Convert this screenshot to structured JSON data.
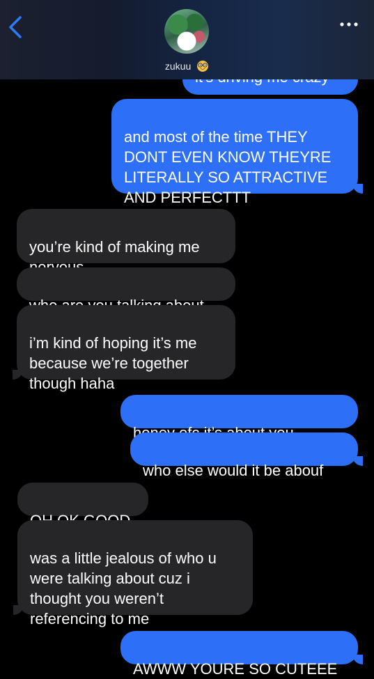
{
  "header": {
    "contact_name": "zukuu",
    "contact_emoji_icon": "nerd-face-emoji-icon"
  },
  "messages": [
    {
      "id": "m0",
      "direction": "outgoing",
      "text": "it's driving me crazy"
    },
    {
      "id": "m1",
      "direction": "outgoing",
      "text": "and most of the time THEY\nDONT EVEN KNOW THEYRE\nLITERALLY SO ATTRACTIVE\nAND PERFECTTT"
    },
    {
      "id": "m2",
      "direction": "incoming",
      "text": "you’re kind of making me\nnervous"
    },
    {
      "id": "m3",
      "direction": "incoming",
      "text": "who are you talking about"
    },
    {
      "id": "m4",
      "direction": "incoming",
      "text": "i’m kind of hoping it’s me\nbecause we’re together\nthough haha"
    },
    {
      "id": "m5",
      "direction": "outgoing",
      "text": "honey ofc it’s about you",
      "emoji_icon": "loudly-crying-face-emoji-icon"
    },
    {
      "id": "m6",
      "direction": "outgoing",
      "text": "who else would it be abouf"
    },
    {
      "id": "m7",
      "direction": "incoming",
      "text": "OH OK GOOD"
    },
    {
      "id": "m8",
      "direction": "incoming",
      "text": "was a little jealous of who u\nwere talking about cuz i\nthought you weren’t\nreferencing to me"
    },
    {
      "id": "m9",
      "direction": "outgoing",
      "text": "AWWW YOURE SO CUTEEE"
    }
  ],
  "colors": {
    "outgoing_bubble": "#2d6ff6",
    "incoming_bubble": "#262628",
    "background": "#000000",
    "accent": "#2d6ff6"
  }
}
